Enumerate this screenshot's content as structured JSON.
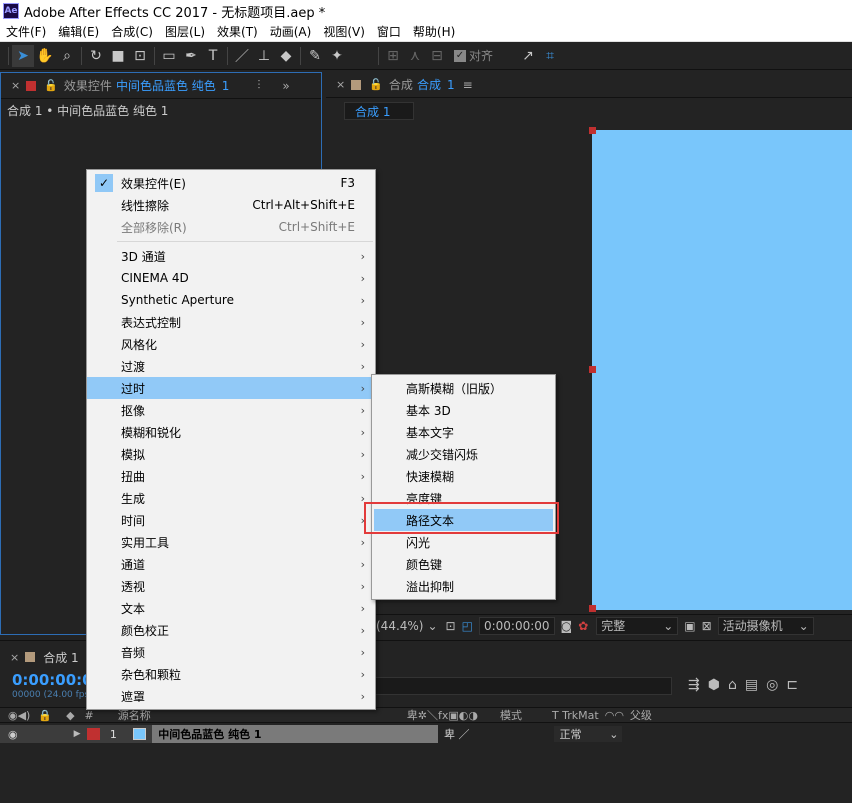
{
  "window": {
    "title": "Adobe After Effects CC 2017 - 无标题项目.aep *",
    "logo": "Ae"
  },
  "menubar": [
    "文件(F)",
    "编辑(E)",
    "合成(C)",
    "图层(L)",
    "效果(T)",
    "动画(A)",
    "视图(V)",
    "窗口",
    "帮助(H)"
  ],
  "toolbar": {
    "snap_label": "对齐"
  },
  "effects_panel": {
    "tab_label_prefix": "效果控件",
    "tab_label_layer": "中间色品蓝色 纯色",
    "tab_label_index": "1",
    "breadcrumb": "合成 1 • 中间色品蓝色 纯色 1",
    "swatch_color": "#c03030"
  },
  "comp_panel": {
    "tab_prefix": "合成",
    "tab_name": "合成",
    "tab_index": "1",
    "chip_label": "合成 1",
    "canvas_color": "#79c6fb",
    "zoom": "(44.4%)",
    "time": "0:00:00:00",
    "resolution": "完整",
    "camera": "活动摄像机"
  },
  "timeline": {
    "tab_label": "合成 1",
    "timecode": "0:00:00:0",
    "fps": "00000 (24.00 fps)",
    "col_source": "源名称",
    "col_mode": "模式",
    "col_trkmat": "T  TrkMat",
    "col_parent": "父级",
    "layer": {
      "index": "1",
      "name": "中间色品蓝色 纯色 1",
      "mode": "正常",
      "label_color": "#c03030",
      "solid_color": "#79c6fb"
    }
  },
  "context_menu": {
    "items": [
      {
        "label": "效果控件(E)",
        "shortcut": "F3",
        "checked": true
      },
      {
        "label": "线性擦除",
        "shortcut": "Ctrl+Alt+Shift+E"
      },
      {
        "label": "全部移除(R)",
        "shortcut": "Ctrl+Shift+E",
        "disabled": true
      }
    ],
    "categories": [
      "3D 通道",
      "CINEMA 4D",
      "Synthetic Aperture",
      "表达式控制",
      "风格化",
      "过渡",
      "过时",
      "抠像",
      "模糊和锐化",
      "模拟",
      "扭曲",
      "生成",
      "时间",
      "实用工具",
      "通道",
      "透视",
      "文本",
      "颜色校正",
      "音频",
      "杂色和颗粒",
      "遮罩"
    ],
    "highlighted": "过时"
  },
  "submenu": {
    "items": [
      "高斯模糊（旧版）",
      "基本 3D",
      "基本文字",
      "减少交错闪烁",
      "快速模糊",
      "亮度键",
      "路径文本",
      "闪光",
      "颜色键",
      "溢出抑制"
    ],
    "highlighted": "路径文本"
  },
  "annotation_color": "#e23b3b"
}
